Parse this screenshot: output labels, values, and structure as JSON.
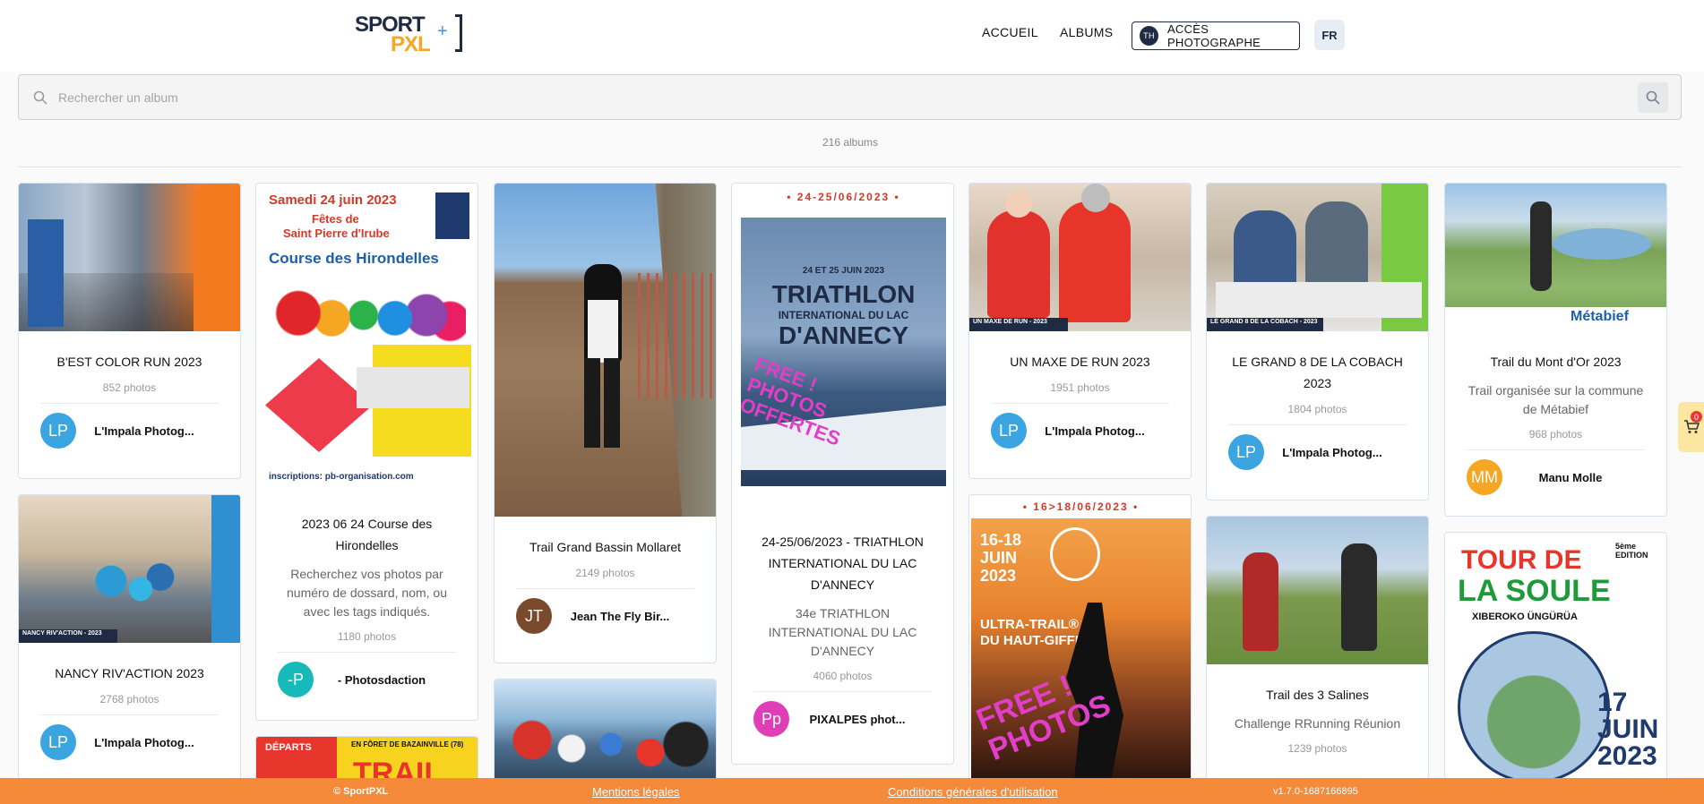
{
  "header": {
    "logo_top": "SPORT",
    "logo_bottom": "PXL",
    "logo_plus": "+",
    "nav_accueil": "ACCUEIL",
    "nav_albums": "ALBUMS",
    "photographe_initials": "TH",
    "photographe_label": "ACCÈS PHOTOGRAPHE",
    "lang": "FR"
  },
  "search": {
    "placeholder": "Rechercher un album",
    "value": ""
  },
  "albums_count": "216 albums",
  "cards": {
    "c1": {
      "title": "B'EST COLOR RUN 2023",
      "photos": "852 photos",
      "initials": "LP",
      "author": "L'Impala Photog..."
    },
    "c2": {
      "title": "NANCY RIV'ACTION 2023",
      "photos": "2768 photos",
      "initials": "LP",
      "author": "L'Impala Photog..."
    },
    "c3": {
      "title": "2023 06 24 Course des Hirondelles",
      "desc": "Recherchez vos photos par numéro de dossard, nom, ou avec les tags indiqués.",
      "photos": "1180 photos",
      "initials": "-P",
      "author": "- Photosdaction"
    },
    "c4": {
      "title": "Trail Grand Bassin Mollaret",
      "photos": "2149 photos",
      "initials": "JT",
      "author": "Jean The Fly Bir..."
    },
    "c5": {
      "title": "24-25/06/2023 - TRIATHLON INTERNATIONAL DU LAC D'ANNECY",
      "desc": "34e TRIATHLON INTERNATIONAL DU LAC D'ANNECY",
      "photos": "4060 photos",
      "initials": "Pp",
      "author": "PIXALPES phot..."
    },
    "c6": {
      "title": "UN MAXE DE RUN 2023",
      "photos": "1951 photos",
      "initials": "LP",
      "author": "L'Impala Photog..."
    },
    "c7": {
      "title": "LE GRAND 8 DE LA COBACH 2023",
      "photos": "1804 photos",
      "initials": "LP",
      "author": "L'Impala Photog..."
    },
    "c8": {
      "title": "Trail des 3 Salines",
      "desc": "Challenge RRunning Réunion",
      "photos": "1239 photos"
    },
    "c9": {
      "title": "Trail du Mont d'Or 2023",
      "desc": "Trail organisée sur la commune de Métabief",
      "photos": "968 photos",
      "initials": "MM",
      "author": "Manu Molle"
    }
  },
  "posters": {
    "hirondelles_date": "Samedi 24 juin 2023",
    "hirondelles_sub1": "Fêtes de",
    "hirondelles_sub2": "Saint Pierre d'Irube",
    "hirondelles_title": "Course des Hirondelles",
    "hirondelles_footer": "inscriptions: pb-organisation.com",
    "triathlon_dates": "• 24-25/06/2023 •",
    "triathlon_sub": "24 ET 25 JUIN 2023",
    "triathlon_title1": "TRIATHLON",
    "triathlon_title2": "INTERNATIONAL DU LAC",
    "triathlon_title3": "D'ANNECY",
    "triathlon_free": "FREE ! PHOTOS OFFERTES",
    "ultra_dates": "• 16>18/06/2023 •",
    "ultra_date2": "16-18 JUIN 2023",
    "ultra_title1": "ULTRA-TRAIL®",
    "ultra_title2": "DU HAUT-GIFFRE",
    "ultra_free": "FREE ! PHOTOS",
    "maxe_tag": "UN MAXE DE RUN - 2023",
    "cobach_tag": "LE GRAND 8 DE LA COBACH - 2023",
    "nancy_tag": "NANCY RIV'ACTION - 2023",
    "metabief": "Métabief",
    "soule_title1": "TOUR DE",
    "soule_title2": "LA SOULE",
    "soule_sub": "XIBEROKO ÜNGÜRÜA",
    "soule_date": "17 JUIN 2023",
    "soule_edition": "5ème EDITION",
    "bazanville_title": "TRAIL",
    "bazanville_sub": "EN FÔRET DE BAZAINVILLE (78)",
    "bazanville_departs": "DÉPARTS"
  },
  "cart_count": "0",
  "footer": {
    "copyright": "© SportPXL",
    "legal": "Mentions légales",
    "cgu": "Conditions générales d'utilisation",
    "version": "v1.7.0-1687166895"
  },
  "colors": {
    "avatar_lp": "#3aa5e0",
    "avatar_p": "#18b9b9",
    "avatar_jt": "#7a4a2e",
    "avatar_pp": "#e03eb6",
    "avatar_mm": "#f5a623",
    "footer": "#f58a3a",
    "cart": "#fbe6a2"
  }
}
